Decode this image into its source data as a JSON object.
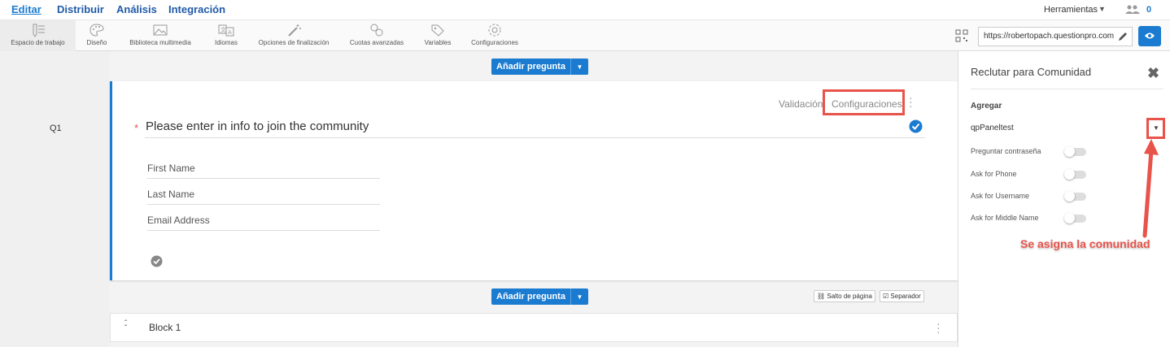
{
  "topnav": {
    "items": [
      {
        "label": "Editar",
        "active": true
      },
      {
        "label": "Distribuir"
      },
      {
        "label": "Análisis"
      },
      {
        "label": "Integración"
      }
    ],
    "tools_label": "Herramientas",
    "tools_caret": "▼",
    "collaborators_count": "0"
  },
  "toolbar": {
    "items": [
      {
        "label": "Espacio de trabajo",
        "icon": "workspace-icon"
      },
      {
        "label": "Diseño",
        "icon": "palette-icon"
      },
      {
        "label": "Biblioteca multimedia",
        "icon": "image-icon"
      },
      {
        "label": "Idiomas",
        "icon": "language-icon"
      },
      {
        "label": "Opciones de finalización",
        "icon": "magic-wand-icon"
      },
      {
        "label": "Cuotas avanzadas",
        "icon": "link-icon"
      },
      {
        "label": "Variables",
        "icon": "tag-icon"
      },
      {
        "label": "Configuraciones",
        "icon": "gear-icon"
      }
    ],
    "survey_url": "https://robertopach.questionpro.com"
  },
  "canvas": {
    "add_question_label": "Añadir pregunta",
    "caret": "▼",
    "question_number": "Q1",
    "question": {
      "validation_link": "Validación",
      "settings_link": "Configuraciones",
      "required_marker": "*",
      "title": "Please enter in info to join the community",
      "fields": [
        "First Name",
        "Last Name",
        "Email Address"
      ]
    },
    "page_break_label": "Salto de página",
    "separator_label": "Separador",
    "block_name": "Block 1"
  },
  "panel": {
    "title": "Reclutar para Comunidad",
    "close": "✖",
    "add_label": "Agregar",
    "selected_panel": "qpPaneltest",
    "dropdown_caret": "▼",
    "options": [
      {
        "label": "Preguntar contraseña",
        "enabled": false
      },
      {
        "label": "Ask for Phone",
        "enabled": false
      },
      {
        "label": "Ask for Username",
        "enabled": false
      },
      {
        "label": "Ask for Middle Name",
        "enabled": false
      }
    ]
  },
  "annotation": {
    "text": "Se asigna la comunidad",
    "color": "#e8534a"
  },
  "colors": {
    "accent": "#1a7bd0",
    "highlight": "#e8534a"
  }
}
